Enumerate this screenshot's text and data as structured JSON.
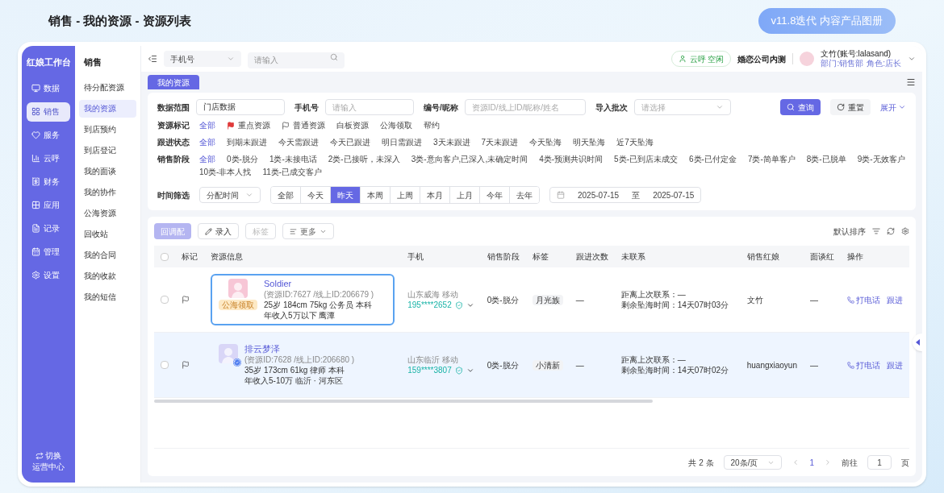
{
  "page_title": "销售 - 我的资源 - 资源列表",
  "version_badge": "v11.8迭代 内容产品图册",
  "app": {
    "brand": "红娘工作台",
    "nav": [
      {
        "label": "数据",
        "selected": false
      },
      {
        "label": "销售",
        "selected": true
      },
      {
        "label": "服务",
        "selected": false
      },
      {
        "label": "云呼",
        "selected": false
      },
      {
        "label": "财务",
        "selected": false
      },
      {
        "label": "应用",
        "selected": false
      },
      {
        "label": "记录",
        "selected": false
      },
      {
        "label": "管理",
        "selected": false
      },
      {
        "label": "设置",
        "selected": false
      }
    ],
    "switch_center": [
      "切换",
      "运营中心"
    ],
    "subnav": {
      "title": "销售",
      "items": [
        {
          "label": "待分配资源",
          "selected": false
        },
        {
          "label": "我的资源",
          "selected": true
        },
        {
          "label": "到店预约",
          "selected": false
        },
        {
          "label": "到店登记",
          "selected": false
        },
        {
          "label": "我的面谈",
          "selected": false
        },
        {
          "label": "我的协作",
          "selected": false
        },
        {
          "label": "公海资源",
          "selected": false
        },
        {
          "label": "回收站",
          "selected": false
        },
        {
          "label": "我的合同",
          "selected": false
        },
        {
          "label": "我的收款",
          "selected": false
        },
        {
          "label": "我的短信",
          "selected": false
        }
      ]
    },
    "topbar": {
      "search_type": "手机号",
      "search_placeholder": "请输入",
      "call_status": "云呼 空闲",
      "company": "婚恋公司内测",
      "user": "文竹(账号:lalasand)",
      "department": "部门:销售部",
      "role": "角色:店长"
    },
    "page_tab": "我的资源",
    "filters": {
      "fields": [
        {
          "label": "数据范围",
          "value": "门店数据",
          "kind": "text"
        },
        {
          "label": "手机号",
          "placeholder": "请输入",
          "kind": "text"
        },
        {
          "label": "编号/昵称",
          "placeholder": "资源ID/线上ID/昵称/姓名",
          "kind": "text"
        },
        {
          "label": "导入批次",
          "placeholder": "请选择",
          "kind": "select"
        }
      ],
      "query_button": "查询",
      "reset_button": "重置",
      "expand_link": "展开",
      "option_rows": [
        {
          "label": "资源标记",
          "options": [
            {
              "label": "全部",
              "selected": true
            },
            {
              "label": "重点资源",
              "selected": false,
              "kind": "flag"
            },
            {
              "label": "普通资源",
              "selected": false,
              "kind": "outline-flag"
            },
            {
              "label": "白板资源",
              "selected": false
            },
            {
              "label": "公海领取",
              "selected": false
            },
            {
              "label": "帮约",
              "selected": false
            }
          ]
        },
        {
          "label": "跟进状态",
          "options": [
            {
              "label": "全部",
              "selected": true
            },
            {
              "label": "到期未跟进",
              "selected": false
            },
            {
              "label": "今天需跟进",
              "selected": false
            },
            {
              "label": "今天已跟进",
              "selected": false
            },
            {
              "label": "明日需跟进",
              "selected": false
            },
            {
              "label": "3天未跟进",
              "selected": false
            },
            {
              "label": "7天未跟进",
              "selected": false
            },
            {
              "label": "今天坠海",
              "selected": false
            },
            {
              "label": "明天坠海",
              "selected": false
            },
            {
              "label": "近7天坠海",
              "selected": false
            }
          ]
        },
        {
          "label": "销售阶段",
          "options": [
            {
              "label": "全部",
              "selected": true
            },
            {
              "label": "0类-脱分",
              "selected": false
            },
            {
              "label": "1类-未接电话",
              "selected": false
            },
            {
              "label": "2类-已接听，未深入",
              "selected": false
            },
            {
              "label": "3类-意向客户,已深入,未确定时间",
              "selected": false
            },
            {
              "label": "4类-预测共识时间",
              "selected": false
            },
            {
              "label": "5类-已到店未成交",
              "selected": false
            },
            {
              "label": "6类-已付定金",
              "selected": false
            },
            {
              "label": "7类-简单客户",
              "selected": false
            },
            {
              "label": "8类-已脱单",
              "selected": false
            },
            {
              "label": "9类-无效客户",
              "selected": false
            },
            {
              "label": "10类-非本人找",
              "selected": false
            },
            {
              "label": "11类-已成交客户",
              "selected": false
            }
          ]
        }
      ],
      "time": {
        "label": "时间筛选",
        "type": "分配时间",
        "ranges": [
          {
            "label": "全部",
            "selected": false
          },
          {
            "label": "今天",
            "selected": false
          },
          {
            "label": "昨天",
            "selected": true
          },
          {
            "label": "本周",
            "selected": false
          },
          {
            "label": "上周",
            "selected": false
          },
          {
            "label": "本月",
            "selected": false
          },
          {
            "label": "上月",
            "selected": false
          },
          {
            "label": "今年",
            "selected": false
          },
          {
            "label": "去年",
            "selected": false
          }
        ],
        "start": "2025-07-15",
        "separator": "至",
        "end": "2025-07-15"
      }
    },
    "toolbar": {
      "buttons": [
        {
          "label": "回调配",
          "disabled": true,
          "kind": "primary"
        },
        {
          "label": "录入",
          "disabled": false,
          "kind": "edit"
        },
        {
          "label": "标签",
          "disabled": true,
          "kind": "plain"
        },
        {
          "label": "更多",
          "disabled": false,
          "kind": "menu"
        }
      ],
      "sort": "默认排序"
    },
    "table": {
      "all_checked": false,
      "columns": [
        "标记",
        "资源信息",
        "手机",
        "销售阶段",
        "标签",
        "跟进次数",
        "未联系",
        "销售红娘",
        "面谈红",
        "操作"
      ],
      "rows": [
        {
          "highlighted": false,
          "outlined": true,
          "name": "Soldier",
          "ids": "(资源ID:7627 /线上ID:206679 )",
          "details": "25岁 184cm 75kg 公务员 本科",
          "income": "年收入5万以下 鹰潭",
          "badge": "公海领取",
          "verified": false,
          "checked": false,
          "color": "#f7c6d6",
          "carrier": "山东威海 移动",
          "phone": "195****2652",
          "stage": "0类-脱分",
          "tag": "月光族",
          "followups": "—",
          "last_contact": "距离上次联系：—",
          "drop_time": "剩余坠海时间：14天07时03分",
          "rep": "文竹",
          "interviewer": "—",
          "actions": [
            "打电话",
            "跟进"
          ]
        },
        {
          "highlighted": true,
          "outlined": false,
          "name": "排云梦泽",
          "ids": "(资源ID:7628 /线上ID:206680 )",
          "details": "35岁 173cm 61kg 律师 本科",
          "income": "年收入5-10万 临沂 · 河东区",
          "verified": true,
          "checked": false,
          "color": "#d9d6f7",
          "carrier": "山东临沂 移动",
          "phone": "159****3807",
          "stage": "0类-脱分",
          "tag": "小清新",
          "followups": "—",
          "last_contact": "距离上次联系：—",
          "drop_time": "剩余坠海时间：14天07时02分",
          "rep": "huangxiaoyun",
          "interviewer": "—",
          "actions": [
            "打电话",
            "跟进"
          ]
        }
      ]
    },
    "pagination": {
      "total": "共 2 条",
      "page_size": "20条/页",
      "current": "1",
      "goto_label": "前往",
      "goto_value": "1",
      "page_unit": "页"
    }
  }
}
